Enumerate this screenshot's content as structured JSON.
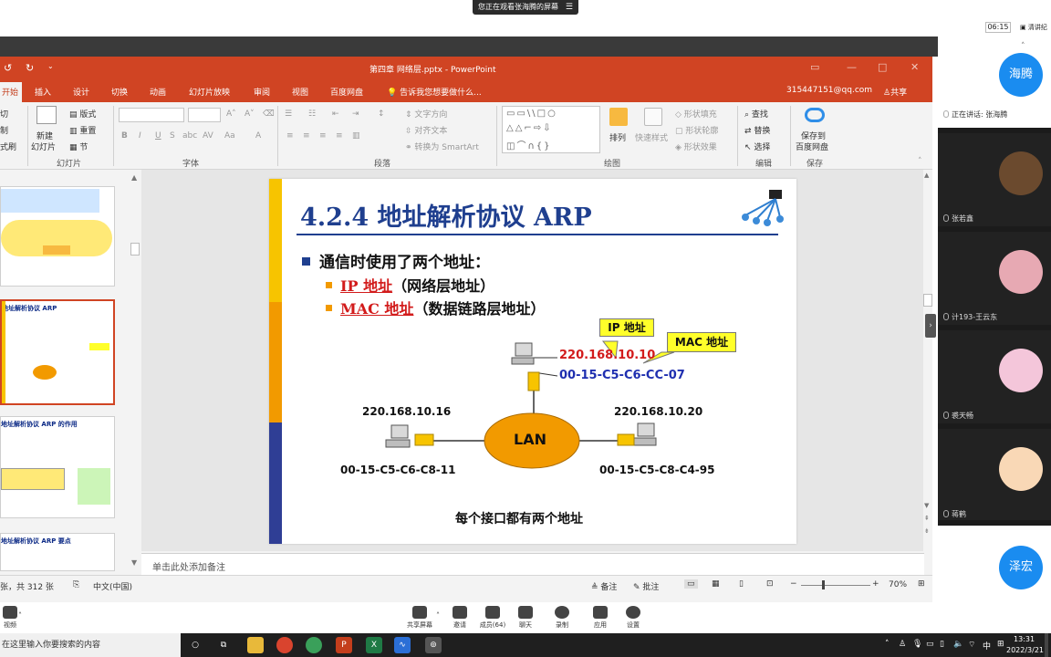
{
  "screen_share": {
    "notice": "您正在观看张海腾的屏幕",
    "notice_icon": "menu-icon",
    "clock": "06:15",
    "doc_list": "清讲纪"
  },
  "powerpoint": {
    "window_title": "第四章 网络层.pptx - PowerPoint",
    "tabs": [
      "开始",
      "插入",
      "设计",
      "切换",
      "动画",
      "幻灯片放映",
      "审阅",
      "视图",
      "百度网盘"
    ],
    "tell_me": "告诉我您想要做什么...",
    "account": "315447151@qq.com",
    "share": "共享",
    "ribbon": {
      "clipboard": {
        "cut": "切",
        "copy": "制",
        "painter": "式刷",
        "label": ""
      },
      "slides": {
        "new_slide": "新建",
        "new_slide2": "幻灯片",
        "layout": "版式",
        "reset": "重置",
        "section": "节",
        "label": "幻灯片"
      },
      "font_label": "字体",
      "paragraph": {
        "text_dir": "文字方向",
        "align_text": "对齐文本",
        "smartart": "转换为 SmartArt",
        "label": "段落"
      },
      "drawing": {
        "arrange": "排列",
        "quick_styles": "快速样式",
        "fill": "形状填充",
        "outline": "形状轮廓",
        "effects": "形状效果",
        "label": "绘图"
      },
      "editing": {
        "find": "查找",
        "replace": "替换",
        "select": "选择",
        "label": "编辑"
      },
      "save": {
        "line1": "保存到",
        "line2": "百度网盘",
        "label": "保存"
      }
    },
    "thumbnails": [
      {
        "title": ""
      },
      {
        "title": "地址解析协议 ARP"
      },
      {
        "title": "地址解析协议 ARP 的作用"
      },
      {
        "title": "地址解析协议 ARP 要点"
      }
    ],
    "slide": {
      "title": "4.2.4  地址解析协议 ARP",
      "bullet1": "通信时使用了两个地址：",
      "sub1_red": "IP 地址",
      "sub1_rest": "（网络层地址）",
      "sub2_red": "MAC 地址",
      "sub2_rest": "（数据链路层地址）",
      "callout_ip": "IP 地址",
      "callout_mac": "MAC 地址",
      "top_ip": "220.168.10.10",
      "top_mac": "00-15-C5-C6-CC-07",
      "left_ip": "220.168.10.16",
      "left_mac": "00-15-C5-C6-C8-11",
      "right_ip": "220.168.10.20",
      "right_mac": "00-15-C5-C8-C4-95",
      "lan": "LAN",
      "caption": "每个接口都有两个地址"
    },
    "notes_placeholder": "单击此处添加备注",
    "status": {
      "slide_count": "张，共 312 张",
      "language": "中文(中国)",
      "notes": "备注",
      "comments": "批注",
      "zoom": "70%"
    }
  },
  "participants": [
    {
      "name": "海腾",
      "type": "avatar"
    },
    {
      "name": "正在讲话: 张海腾",
      "type": "speaking"
    },
    {
      "name": "张若鑫",
      "type": "photo"
    },
    {
      "name": "计193-王云东",
      "type": "photo"
    },
    {
      "name": "裘天畅",
      "type": "photo"
    },
    {
      "name": "蒋鹤",
      "type": "photo"
    },
    {
      "name": "泽宏",
      "type": "avatar"
    }
  ],
  "meeting_toolbar": {
    "left_label": "视频",
    "items": [
      "共享屏幕",
      "邀请",
      "成员(64)",
      "聊天",
      "录制",
      "应用",
      "设置"
    ]
  },
  "taskbar": {
    "search_placeholder": "在这里输入你要搜索的内容",
    "ime": "中",
    "time": "13:31",
    "date": "2022/3/21"
  },
  "colors": {
    "ppt_accent": "#d04423",
    "slide_title": "#1f3f8f",
    "red_text": "#d21b1b",
    "blue_text": "#1f2fb0",
    "lan_fill": "#f29a00",
    "callout": "#ffff2a"
  }
}
